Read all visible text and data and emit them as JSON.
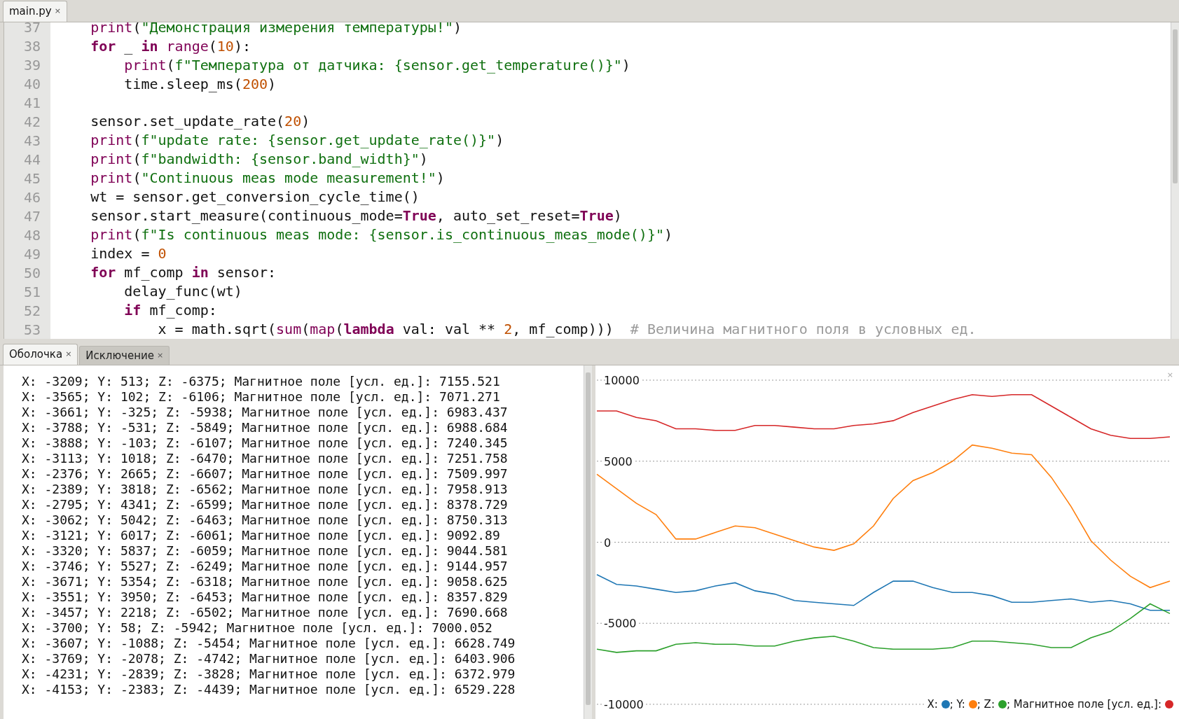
{
  "editor": {
    "tabs": [
      {
        "label": "main.py",
        "close": "×",
        "selected": true
      }
    ],
    "lines": [
      {
        "number": "37",
        "tokens": [
          {
            "text": "    print",
            "kind": "builtin"
          },
          {
            "text": "(",
            "kind": "plain"
          },
          {
            "text": "\"Демонстрация измерения температуры!\"",
            "kind": "string"
          },
          {
            "text": ")",
            "kind": "plain"
          }
        ]
      },
      {
        "number": "38",
        "tokens": [
          {
            "text": "    for",
            "kind": "keyword"
          },
          {
            "text": " _ ",
            "kind": "plain"
          },
          {
            "text": "in",
            "kind": "keyword"
          },
          {
            "text": " range",
            "kind": "builtin"
          },
          {
            "text": "(",
            "kind": "plain"
          },
          {
            "text": "10",
            "kind": "number"
          },
          {
            "text": "):",
            "kind": "plain"
          }
        ]
      },
      {
        "number": "39",
        "tokens": [
          {
            "text": "        print",
            "kind": "builtin"
          },
          {
            "text": "(",
            "kind": "plain"
          },
          {
            "text": "f\"Температура от датчика: {sensor.get_temperature()}\"",
            "kind": "string"
          },
          {
            "text": ")",
            "kind": "plain"
          }
        ]
      },
      {
        "number": "40",
        "tokens": [
          {
            "text": "        time.sleep_ms(",
            "kind": "plain"
          },
          {
            "text": "200",
            "kind": "number"
          },
          {
            "text": ")",
            "kind": "plain"
          }
        ]
      },
      {
        "number": "41"
      },
      {
        "number": "42",
        "tokens": [
          {
            "text": "    sensor.set_update_rate(",
            "kind": "plain"
          },
          {
            "text": "20",
            "kind": "number"
          },
          {
            "text": ")",
            "kind": "plain"
          }
        ]
      },
      {
        "number": "43",
        "tokens": [
          {
            "text": "    print",
            "kind": "builtin"
          },
          {
            "text": "(",
            "kind": "plain"
          },
          {
            "text": "f\"update rate: {sensor.get_update_rate()}\"",
            "kind": "string"
          },
          {
            "text": ")",
            "kind": "plain"
          }
        ]
      },
      {
        "number": "44",
        "tokens": [
          {
            "text": "    print",
            "kind": "builtin"
          },
          {
            "text": "(",
            "kind": "plain"
          },
          {
            "text": "f\"bandwidth: {sensor.band_width}\"",
            "kind": "string"
          },
          {
            "text": ")",
            "kind": "plain"
          }
        ]
      },
      {
        "number": "45",
        "tokens": [
          {
            "text": "    print",
            "kind": "builtin"
          },
          {
            "text": "(",
            "kind": "plain"
          },
          {
            "text": "\"Continuous meas mode measurement!\"",
            "kind": "string"
          },
          {
            "text": ")",
            "kind": "plain"
          }
        ]
      },
      {
        "number": "46",
        "tokens": [
          {
            "text": "    wt = sensor.get_conversion_cycle_time()",
            "kind": "plain"
          }
        ]
      },
      {
        "number": "47",
        "tokens": [
          {
            "text": "    sensor.start_measure(continuous_mode=",
            "kind": "plain"
          },
          {
            "text": "True",
            "kind": "keyword"
          },
          {
            "text": ", auto_set_reset=",
            "kind": "plain"
          },
          {
            "text": "True",
            "kind": "keyword"
          },
          {
            "text": ")",
            "kind": "plain"
          }
        ]
      },
      {
        "number": "48",
        "tokens": [
          {
            "text": "    print",
            "kind": "builtin"
          },
          {
            "text": "(",
            "kind": "plain"
          },
          {
            "text": "f\"Is continuous meas mode: {sensor.is_continuous_meas_mode()}\"",
            "kind": "string"
          },
          {
            "text": ")",
            "kind": "plain"
          }
        ]
      },
      {
        "number": "49",
        "tokens": [
          {
            "text": "    index = ",
            "kind": "plain"
          },
          {
            "text": "0",
            "kind": "number"
          }
        ]
      },
      {
        "number": "50",
        "tokens": [
          {
            "text": "    for",
            "kind": "keyword"
          },
          {
            "text": " mf_comp ",
            "kind": "plain"
          },
          {
            "text": "in",
            "kind": "keyword"
          },
          {
            "text": " sensor:",
            "kind": "plain"
          }
        ]
      },
      {
        "number": "51",
        "tokens": [
          {
            "text": "        delay_func(wt)",
            "kind": "plain"
          }
        ]
      },
      {
        "number": "52",
        "tokens": [
          {
            "text": "        if",
            "kind": "keyword"
          },
          {
            "text": " mf_comp:",
            "kind": "plain"
          }
        ]
      },
      {
        "number": "53",
        "tokens": [
          {
            "text": "            x = math.sqrt(",
            "kind": "plain"
          },
          {
            "text": "sum",
            "kind": "builtin"
          },
          {
            "text": "(",
            "kind": "plain"
          },
          {
            "text": "map",
            "kind": "builtin"
          },
          {
            "text": "(",
            "kind": "plain"
          },
          {
            "text": "lambda",
            "kind": "keyword"
          },
          {
            "text": " val: val ** ",
            "kind": "plain"
          },
          {
            "text": "2",
            "kind": "number"
          },
          {
            "text": ", mf_comp)))  ",
            "kind": "plain"
          },
          {
            "text": "# Величина магнитного поля в условных ед.",
            "kind": "comment"
          }
        ]
      }
    ]
  },
  "shell_tabs": [
    {
      "label": "Оболочка",
      "close": "×",
      "selected": true
    },
    {
      "label": "Исключение",
      "close": "×",
      "selected": false
    }
  ],
  "shell": {
    "lines": [
      "X: -3209; Y: 513; Z: -6375; Магнитное поле [усл. ед.]: 7155.521",
      "X: -3565; Y: 102; Z: -6106; Магнитное поле [усл. ед.]: 7071.271",
      "X: -3661; Y: -325; Z: -5938; Магнитное поле [усл. ед.]: 6983.437",
      "X: -3788; Y: -531; Z: -5849; Магнитное поле [усл. ед.]: 6988.684",
      "X: -3888; Y: -103; Z: -6107; Магнитное поле [усл. ед.]: 7240.345",
      "X: -3113; Y: 1018; Z: -6470; Магнитное поле [усл. ед.]: 7251.758",
      "X: -2376; Y: 2665; Z: -6607; Магнитное поле [усл. ед.]: 7509.997",
      "X: -2389; Y: 3818; Z: -6562; Магнитное поле [усл. ед.]: 7958.913",
      "X: -2795; Y: 4341; Z: -6599; Магнитное поле [усл. ед.]: 8378.729",
      "X: -3062; Y: 5042; Z: -6463; Магнитное поле [усл. ед.]: 8750.313",
      "X: -3121; Y: 6017; Z: -6061; Магнитное поле [усл. ед.]: 9092.89",
      "X: -3320; Y: 5837; Z: -6059; Магнитное поле [усл. ед.]: 9044.581",
      "X: -3746; Y: 5527; Z: -6249; Магнитное поле [усл. ед.]: 9144.957",
      "X: -3671; Y: 5354; Z: -6318; Магнитное поле [усл. ед.]: 9058.625",
      "X: -3551; Y: 3950; Z: -6453; Магнитное поле [усл. ед.]: 8357.829",
      "X: -3457; Y: 2218; Z: -6502; Магнитное поле [усл. ед.]: 7690.668",
      "X: -3700; Y: 58; Z: -5942; Магнитное поле [усл. ед.]: 7000.052",
      "X: -3607; Y: -1088; Z: -5454; Магнитное поле [усл. ед.]: 6628.749",
      "X: -3769; Y: -2078; Z: -4742; Магнитное поле [усл. ед.]: 6403.906",
      "X: -4231; Y: -2839; Z: -3828; Магнитное поле [усл. ед.]: 6372.979",
      "X: -4153; Y: -2383; Z: -4439; Магнитное поле [усл. ед.]: 6529.228"
    ]
  },
  "plotter": {
    "close": "×",
    "legend": {
      "separator": ";",
      "name_suffix": ":"
    },
    "chart_data": {
      "type": "line",
      "grid": true,
      "ylim": [
        -10000,
        10000
      ],
      "yticks": [
        -10000,
        -5000,
        0,
        5000,
        10000
      ],
      "series": [
        {
          "name": "X",
          "color": "#1f77b4",
          "values": [
            -2000,
            -2600,
            -2700,
            -2900,
            -3100,
            -3000,
            -2700,
            -2500,
            -3000,
            -3200,
            -3600,
            -3700,
            -3800,
            -3900,
            -3100,
            -2400,
            -2400,
            -2800,
            -3100,
            -3100,
            -3300,
            -3700,
            -3700,
            -3600,
            -3500,
            -3700,
            -3600,
            -3800,
            -4200,
            -4200
          ]
        },
        {
          "name": "Y",
          "color": "#ff7f0e",
          "values": [
            4200,
            3300,
            2400,
            1700,
            200,
            200,
            600,
            1000,
            900,
            500,
            100,
            -300,
            -500,
            -100,
            1000,
            2700,
            3800,
            4300,
            5000,
            6000,
            5800,
            5500,
            5400,
            4000,
            2200,
            100,
            -1100,
            -2100,
            -2800,
            -2400
          ]
        },
        {
          "name": "Z",
          "color": "#2ca02c",
          "values": [
            -6600,
            -6800,
            -6700,
            -6700,
            -6300,
            -6200,
            -6300,
            -6300,
            -6400,
            -6400,
            -6100,
            -5900,
            -5800,
            -6100,
            -6500,
            -6600,
            -6600,
            -6600,
            -6500,
            -6100,
            -6100,
            -6200,
            -6300,
            -6500,
            -6500,
            -5900,
            -5500,
            -4700,
            -3800,
            -4400
          ]
        },
        {
          "name": "Магнитное поле [усл. ед.]",
          "color": "#d62728",
          "values": [
            8100,
            8100,
            7700,
            7500,
            7000,
            7000,
            6900,
            6900,
            7200,
            7200,
            7100,
            7000,
            7000,
            7200,
            7300,
            7500,
            8000,
            8400,
            8800,
            9100,
            9000,
            9100,
            9100,
            8400,
            7700,
            7000,
            6600,
            6400,
            6400,
            6500
          ]
        }
      ]
    }
  }
}
